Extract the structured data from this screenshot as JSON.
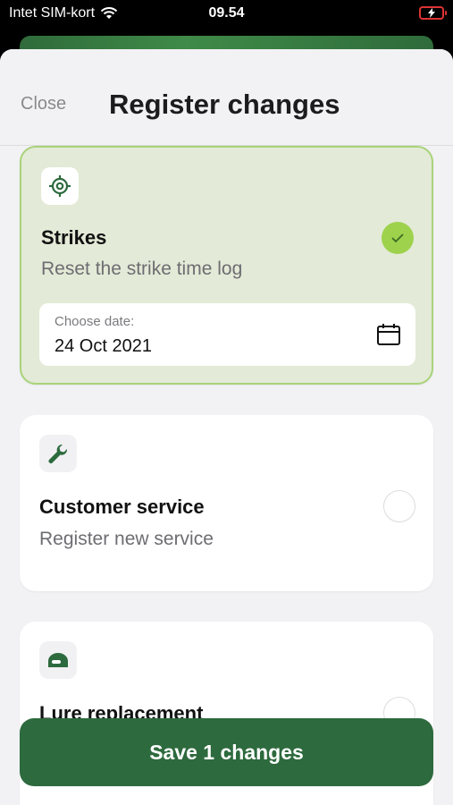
{
  "status_bar": {
    "carrier": "Intet SIM-kort",
    "time": "09.54"
  },
  "header": {
    "close_label": "Close",
    "title": "Register changes"
  },
  "options": [
    {
      "title": "Strikes",
      "subtitle": "Reset the strike time log",
      "icon": "target-icon",
      "selected": true,
      "date_label": "Choose date:",
      "date_value": "24 Oct 2021"
    },
    {
      "title": "Customer service",
      "subtitle": "Register new service",
      "icon": "wrench-icon",
      "selected": false
    },
    {
      "title": "Lure replacement",
      "icon": "lure-icon",
      "selected": false
    }
  ],
  "save_button": {
    "label": "Save 1 changes"
  },
  "colors": {
    "accent_green": "#2d6a3e",
    "check_green": "#9ed24d",
    "selected_bg": "#e3ead7"
  }
}
